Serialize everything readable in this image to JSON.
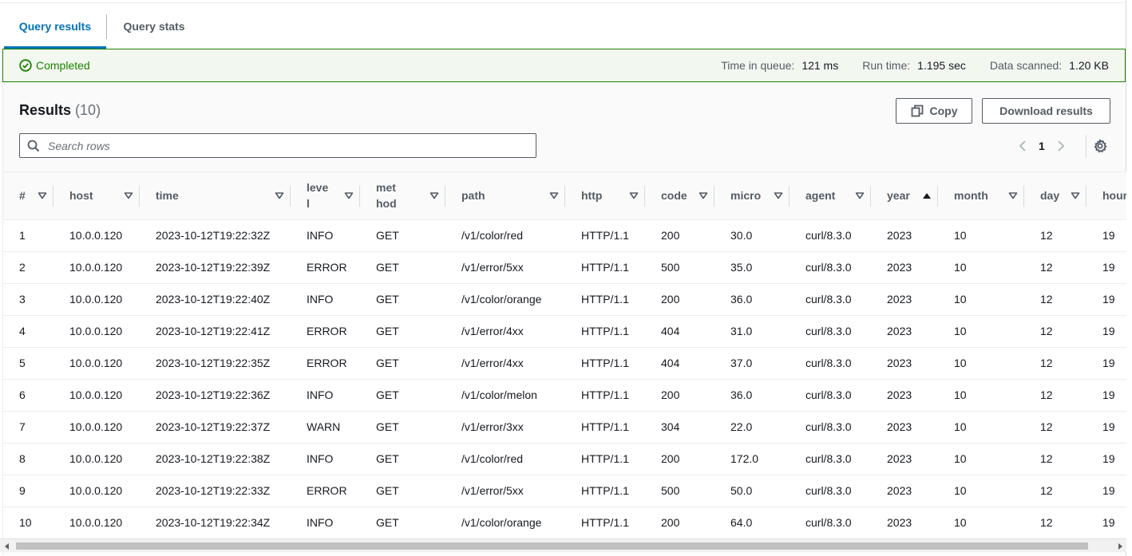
{
  "tabs": [
    {
      "label": "Query results",
      "active": true
    },
    {
      "label": "Query stats",
      "active": false
    }
  ],
  "status": {
    "state": "Completed",
    "time_in_queue_label": "Time in queue:",
    "time_in_queue_value": "121 ms",
    "run_time_label": "Run time:",
    "run_time_value": "1.195 sec",
    "data_scanned_label": "Data scanned:",
    "data_scanned_value": "1.20 KB",
    "color": "#1d8102"
  },
  "results": {
    "title": "Results",
    "count": "(10)",
    "copy_label": "Copy",
    "download_label": "Download results",
    "search_placeholder": "Search rows",
    "page": "1"
  },
  "table": {
    "columns": [
      {
        "label": "#",
        "sort": "filter"
      },
      {
        "label": "host",
        "sort": "filter"
      },
      {
        "label": "time",
        "sort": "filter"
      },
      {
        "label": "level",
        "sort": "filter"
      },
      {
        "label": "method",
        "sort": "filter"
      },
      {
        "label": "path",
        "sort": "filter"
      },
      {
        "label": "http",
        "sort": "filter"
      },
      {
        "label": "code",
        "sort": "filter"
      },
      {
        "label": "micro",
        "sort": "filter"
      },
      {
        "label": "agent",
        "sort": "filter"
      },
      {
        "label": "year",
        "sort": "ascending"
      },
      {
        "label": "month",
        "sort": "filter"
      },
      {
        "label": "day",
        "sort": "filter"
      },
      {
        "label": "hour",
        "sort": "none"
      }
    ],
    "rows": [
      [
        "1",
        "10.0.0.120",
        "2023-10-12T19:22:32Z",
        "INFO",
        "GET",
        "/v1/color/red",
        "HTTP/1.1",
        "200",
        "30.0",
        "curl/8.3.0",
        "2023",
        "10",
        "12",
        "19"
      ],
      [
        "2",
        "10.0.0.120",
        "2023-10-12T19:22:39Z",
        "ERROR",
        "GET",
        "/v1/error/5xx",
        "HTTP/1.1",
        "500",
        "35.0",
        "curl/8.3.0",
        "2023",
        "10",
        "12",
        "19"
      ],
      [
        "3",
        "10.0.0.120",
        "2023-10-12T19:22:40Z",
        "INFO",
        "GET",
        "/v1/color/orange",
        "HTTP/1.1",
        "200",
        "36.0",
        "curl/8.3.0",
        "2023",
        "10",
        "12",
        "19"
      ],
      [
        "4",
        "10.0.0.120",
        "2023-10-12T19:22:41Z",
        "ERROR",
        "GET",
        "/v1/error/4xx",
        "HTTP/1.1",
        "404",
        "31.0",
        "curl/8.3.0",
        "2023",
        "10",
        "12",
        "19"
      ],
      [
        "5",
        "10.0.0.120",
        "2023-10-12T19:22:35Z",
        "ERROR",
        "GET",
        "/v1/error/4xx",
        "HTTP/1.1",
        "404",
        "37.0",
        "curl/8.3.0",
        "2023",
        "10",
        "12",
        "19"
      ],
      [
        "6",
        "10.0.0.120",
        "2023-10-12T19:22:36Z",
        "INFO",
        "GET",
        "/v1/color/melon",
        "HTTP/1.1",
        "200",
        "36.0",
        "curl/8.3.0",
        "2023",
        "10",
        "12",
        "19"
      ],
      [
        "7",
        "10.0.0.120",
        "2023-10-12T19:22:37Z",
        "WARN",
        "GET",
        "/v1/error/3xx",
        "HTTP/1.1",
        "304",
        "22.0",
        "curl/8.3.0",
        "2023",
        "10",
        "12",
        "19"
      ],
      [
        "8",
        "10.0.0.120",
        "2023-10-12T19:22:38Z",
        "INFO",
        "GET",
        "/v1/color/red",
        "HTTP/1.1",
        "200",
        "172.0",
        "curl/8.3.0",
        "2023",
        "10",
        "12",
        "19"
      ],
      [
        "9",
        "10.0.0.120",
        "2023-10-12T19:22:33Z",
        "ERROR",
        "GET",
        "/v1/error/5xx",
        "HTTP/1.1",
        "500",
        "50.0",
        "curl/8.3.0",
        "2023",
        "10",
        "12",
        "19"
      ],
      [
        "10",
        "10.0.0.120",
        "2023-10-12T19:22:34Z",
        "INFO",
        "GET",
        "/v1/color/orange",
        "HTTP/1.1",
        "200",
        "64.0",
        "curl/8.3.0",
        "2023",
        "10",
        "12",
        "19"
      ]
    ]
  },
  "colors": {
    "accent": "#0073bb",
    "success": "#1d8102",
    "border": "#545b64"
  }
}
